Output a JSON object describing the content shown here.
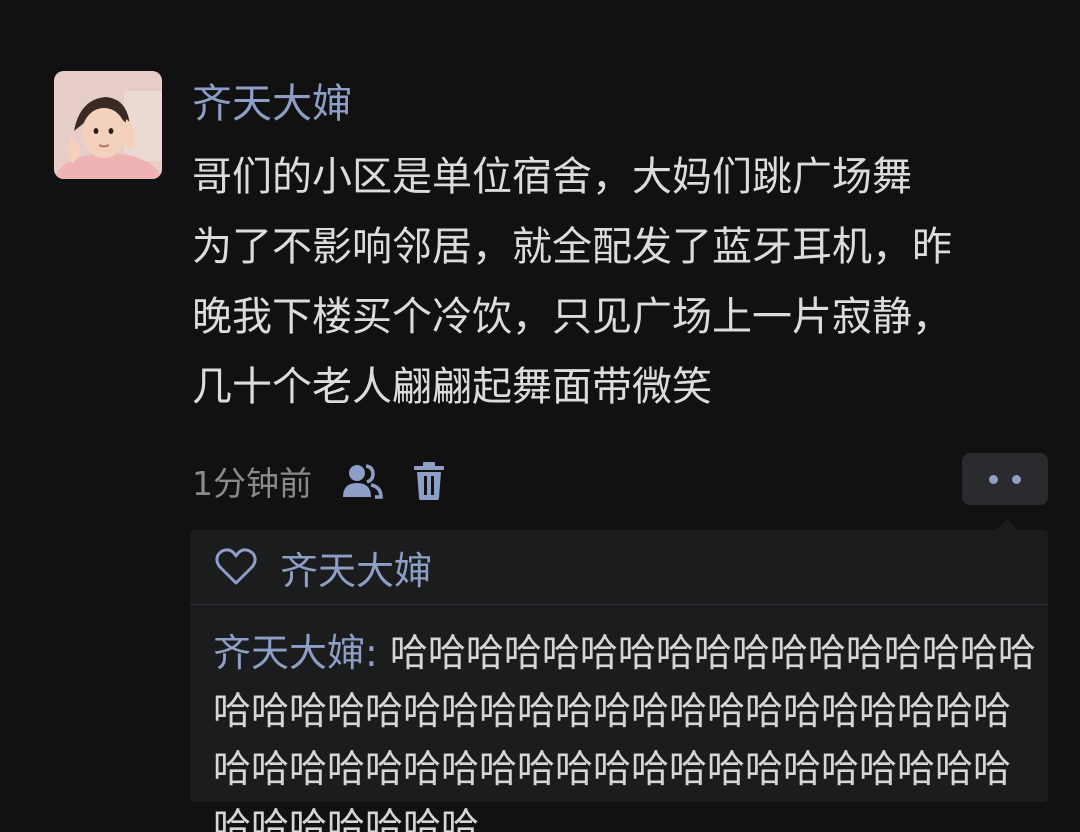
{
  "post": {
    "author": "齐天大婶",
    "content": "哥们的小区是单位宿舍，大妈们跳广场舞\n为了不影响邻居，就全配发了蓝牙耳机，昨\n晚我下楼买个冷饮，只见广场上一片寂静，\n几十个老人翩翩起舞面带微笑",
    "time": "1分钟前",
    "icons": {
      "avatar": "avatar-photo",
      "visibility": "people-icon",
      "delete": "trash-icon",
      "more": "more-dots-icon",
      "like": "heart-icon"
    }
  },
  "likes": {
    "names": "齐天大婶"
  },
  "comments": [
    {
      "author": "齐天大婶",
      "separator": ": ",
      "text": "哈哈哈哈哈哈哈哈哈哈哈哈哈哈哈哈哈哈哈哈哈哈哈哈哈哈哈哈哈哈哈哈哈哈哈哈哈哈哈哈哈哈哈哈哈哈哈哈哈哈哈哈哈哈哈哈哈哈哈哈哈哈哈哈哈哈"
    }
  ],
  "colors": {
    "background": "#111112",
    "name_link": "#8d9fc6",
    "body_text": "#dcdcdc",
    "meta_text": "#8a8a8a",
    "panel": "#1b1c1e"
  }
}
